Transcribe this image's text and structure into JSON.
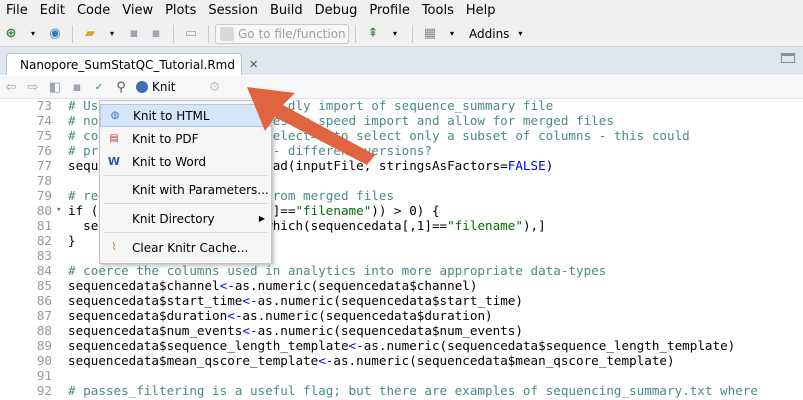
{
  "menubar": {
    "items": [
      "File",
      "Edit",
      "Code",
      "View",
      "Plots",
      "Session",
      "Build",
      "Debug",
      "Profile",
      "Tools",
      "Help"
    ]
  },
  "toolbar": {
    "goto_placeholder": "Go to file/function",
    "addins_label": "Addins"
  },
  "tab": {
    "title": "Nanopore_SumStatQC_Tutorial.Rmd",
    "close": "✕"
  },
  "editor_toolbar": {
    "knit_label": "Knit"
  },
  "knit_menu": {
    "items": [
      {
        "label": "Knit to HTML",
        "icon": "html-icon"
      },
      {
        "label": "Knit to PDF",
        "icon": "pdf-icon"
      },
      {
        "label": "Knit to Word",
        "icon": "word-icon"
      },
      {
        "label": "Knit with Parameters...",
        "icon": ""
      },
      {
        "label": "Knit Directory",
        "icon": ""
      },
      {
        "label": "Clear Knitr Cache...",
        "icon": "broom-icon"
      }
    ]
  },
  "code": {
    "lines": [
      {
        "n": "73",
        "t": "# Us                         dly import of sequence_summary file"
      },
      {
        "n": "74",
        "t": "# no                       es to speed import and allow for merged files"
      },
      {
        "n": "75",
        "t": "# co                      select=) to select only a subset of columns - this could"
      },
      {
        "n": "76",
        "t": "# pr                    ta - different versions?"
      },
      {
        "n": "77",
        "t": "seque                 ::fread(inputFile, stringsAsFactors=FALSE)"
      },
      {
        "n": "78",
        "t": ""
      },
      {
        "n": "79",
        "t": "# re                aders from merged files"
      },
      {
        "n": "80",
        "t": "if (                data[,1]==\"filename\")) > 0) {"
      },
      {
        "n": "81",
        "t": "  se                data[-which(sequencedata[,1]==\"filename\"),]"
      },
      {
        "n": "82",
        "t": "}"
      },
      {
        "n": "83",
        "t": ""
      },
      {
        "n": "84",
        "t": "# coerce the columns used in analytics into more appropriate data-types"
      },
      {
        "n": "85",
        "t": "sequencedata$channel<-as.numeric(sequencedata$channel)"
      },
      {
        "n": "86",
        "t": "sequencedata$start_time<-as.numeric(sequencedata$start_time)"
      },
      {
        "n": "87",
        "t": "sequencedata$duration<-as.numeric(sequencedata$duration)"
      },
      {
        "n": "88",
        "t": "sequencedata$num_events<-as.numeric(sequencedata$num_events)"
      },
      {
        "n": "89",
        "t": "sequencedata$sequence_length_template<-as.numeric(sequencedata$sequence_length_template)"
      },
      {
        "n": "90",
        "t": "sequencedata$mean_qscore_template<-as.numeric(sequencedata$mean_qscore_template)"
      },
      {
        "n": "91",
        "t": ""
      },
      {
        "n": "92",
        "t": "# passes_filtering is a useful flag; but there are examples of sequencing_summary.txt where"
      }
    ]
  }
}
